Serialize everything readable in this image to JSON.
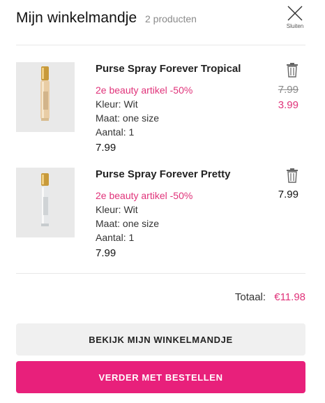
{
  "header": {
    "title": "Mijn winkelmandje",
    "count": "2 producten",
    "close_label": "Sluiten"
  },
  "items": [
    {
      "name": "Purse Spray Forever Tropical",
      "promo": "2e beauty artikel -50%",
      "color": "Kleur: Wit",
      "size": "Maat: one size",
      "quantity": "Aantal: 1",
      "price": "7.99",
      "old_price": "7.99",
      "new_price": "3.99"
    },
    {
      "name": "Purse Spray Forever Pretty",
      "promo": "2e beauty artikel -50%",
      "color": "Kleur: Wit",
      "size": "Maat: one size",
      "quantity": "Aantal: 1",
      "price": "7.99",
      "line_price": "7.99"
    }
  ],
  "totals": {
    "label": "Totaal:",
    "value": "€11.98"
  },
  "buttons": {
    "view_cart": "BEKIJK MIJN WINKELMANDJE",
    "checkout": "VERDER MET BESTELLEN"
  },
  "colors": {
    "accent": "#e8207b",
    "promo": "#e0337a",
    "muted": "#8a8a8a"
  }
}
